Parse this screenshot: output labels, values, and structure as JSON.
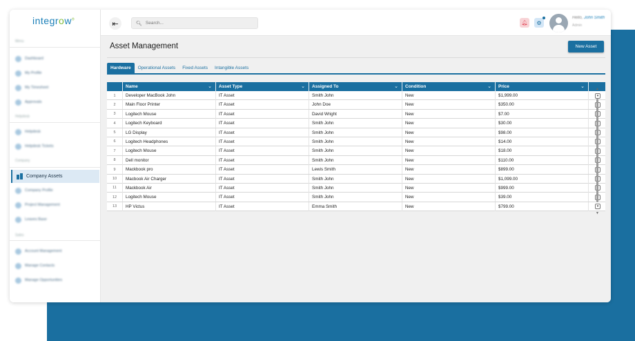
{
  "brand": {
    "logo_start": "integr",
    "logo_oo": "o",
    "logo_end": "w"
  },
  "sidebar": {
    "sections": [
      {
        "label": "Menu",
        "items": [
          "Dashboard",
          "My Profile",
          "My Timesheet",
          "Approvals"
        ]
      },
      {
        "label": "Helpdesk",
        "items": [
          "Helpdesk",
          "Helpdesk Tickets"
        ]
      },
      {
        "label": "Company",
        "items": [
          "Company Assets",
          "Company Profile",
          "Project Management",
          "Leaves Base"
        ]
      },
      {
        "label": "Sales",
        "items": [
          "Account Management",
          "Manage Contacts",
          "Manage Opportunities"
        ]
      }
    ],
    "active_item": "Company Assets"
  },
  "topbar": {
    "search_placeholder": "Search...",
    "greeting": "Hello,",
    "user_name": "John Smith",
    "user_role": "Admin",
    "icons": {
      "menu": "collapse-menu-icon",
      "bell": "bell-icon",
      "settings": "gear-icon"
    }
  },
  "page": {
    "title": "Asset Management",
    "new_button": "New Asset",
    "tabs": [
      "Hardware",
      "Operational Assets",
      "Fixed Assets",
      "Intangible Assets"
    ],
    "active_tab": "Hardware"
  },
  "table": {
    "columns": [
      "Name",
      "Asset Type",
      "Assigned To",
      "Condition",
      "Price"
    ],
    "rows": [
      {
        "n": "1",
        "name": "Developer MacBook John",
        "type": "IT Asset",
        "assigned": "Smith John",
        "condition": "New",
        "price": "$1,999.00"
      },
      {
        "n": "2",
        "name": "Main Floor Printer",
        "type": "IT Asset",
        "assigned": "John Doe",
        "condition": "New",
        "price": "$350.00"
      },
      {
        "n": "3",
        "name": "Logitech Mouse",
        "type": "IT Asset",
        "assigned": "David Wright",
        "condition": "New",
        "price": "$7.00"
      },
      {
        "n": "4",
        "name": "Logitech Keyboard",
        "type": "IT Asset",
        "assigned": "Smith John",
        "condition": "New",
        "price": "$30.00"
      },
      {
        "n": "5",
        "name": "LG Display",
        "type": "IT Asset",
        "assigned": "Smith John",
        "condition": "New",
        "price": "$98.00"
      },
      {
        "n": "6",
        "name": "Logitech Headphones",
        "type": "IT Asset",
        "assigned": "Smith John",
        "condition": "New",
        "price": "$14.00"
      },
      {
        "n": "7",
        "name": "Logitech Mouse",
        "type": "IT Asset",
        "assigned": "Smith John",
        "condition": "New",
        "price": "$18.00"
      },
      {
        "n": "8",
        "name": "Dell monitor",
        "type": "IT Asset",
        "assigned": "Smith John",
        "condition": "New",
        "price": "$110.00"
      },
      {
        "n": "9",
        "name": "Mackbook pro",
        "type": "IT Asset",
        "assigned": "Lewis Smith",
        "condition": "New",
        "price": "$899.00"
      },
      {
        "n": "10",
        "name": "Macbook Air Charger",
        "type": "IT Asset",
        "assigned": "Smith John",
        "condition": "New",
        "price": "$1,099.00"
      },
      {
        "n": "11",
        "name": "Mackbook Air",
        "type": "IT Asset",
        "assigned": "Smith John",
        "condition": "New",
        "price": "$999.00"
      },
      {
        "n": "12",
        "name": "Logitech Mouse",
        "type": "IT Asset",
        "assigned": "Smith John",
        "condition": "New",
        "price": "$39.00"
      },
      {
        "n": "13",
        "name": "HP Victus",
        "type": "IT Asset",
        "assigned": "Emma Smith",
        "condition": "New",
        "price": "$799.00"
      }
    ]
  },
  "colors": {
    "primary": "#1a6fa0",
    "accent_green": "#7fba3b",
    "backdrop_blue": "#1a6fa0"
  }
}
